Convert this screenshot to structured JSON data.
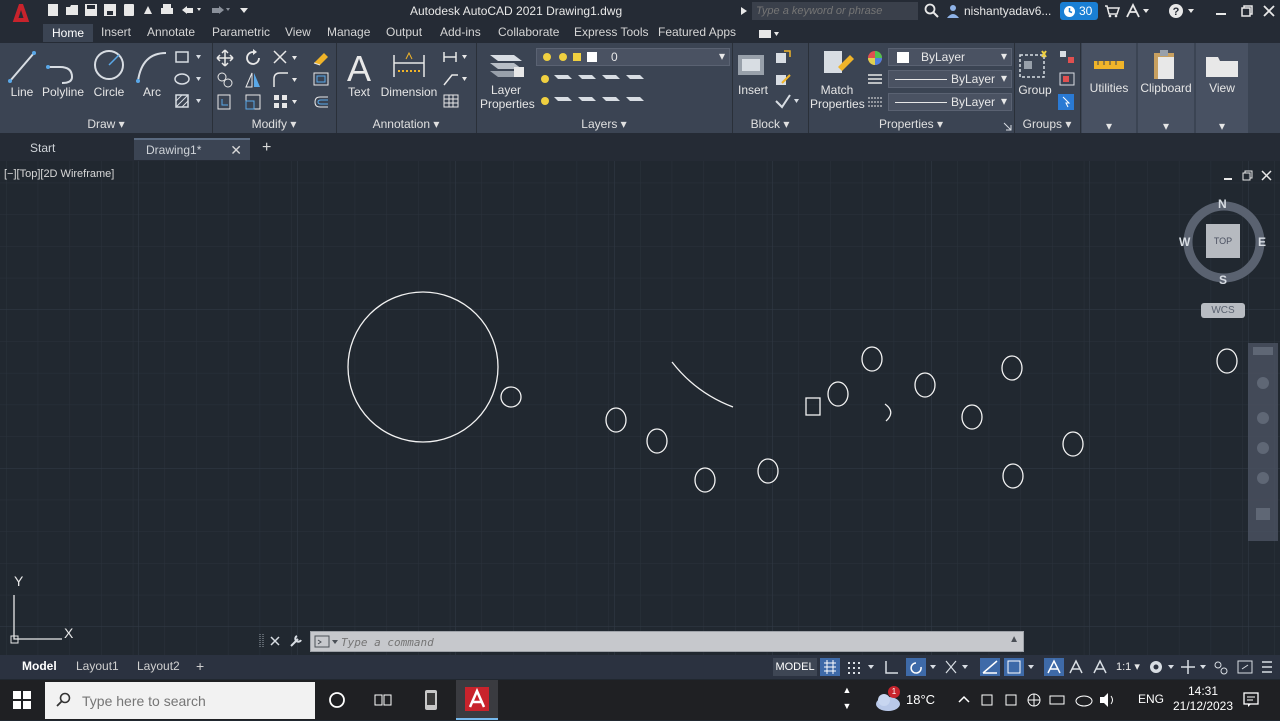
{
  "titlebar": {
    "app_title": "Autodesk AutoCAD 2021   Drawing1.dwg",
    "search_placeholder": "Type a keyword or phrase",
    "user": "nishantyadav6...",
    "trial_days": "30"
  },
  "ribbon_tabs": [
    "Home",
    "Insert",
    "Annotate",
    "Parametric",
    "View",
    "Manage",
    "Output",
    "Add-ins",
    "Collaborate",
    "Express Tools",
    "Featured Apps"
  ],
  "ribbon": {
    "draw": {
      "title": "Draw",
      "tools": [
        "Line",
        "Polyline",
        "Circle",
        "Arc"
      ]
    },
    "modify": {
      "title": "Modify"
    },
    "annotation": {
      "title": "Annotation",
      "tools": [
        "Text",
        "Dimension"
      ]
    },
    "layers": {
      "title": "Layers",
      "layer_properties": [
        "Layer",
        "Properties"
      ],
      "current_layer": "0"
    },
    "block": {
      "title": "Block",
      "insert": "Insert"
    },
    "properties": {
      "title": "Properties",
      "match": [
        "Match",
        "Properties"
      ],
      "color": "ByLayer",
      "linetype": "ByLayer",
      "lineweight": "ByLayer"
    },
    "groups": {
      "title": "Groups",
      "group": "Group"
    },
    "utilities": "Utilities",
    "clipboard": "Clipboard",
    "view": "View"
  },
  "doc_tabs": {
    "start": "Start",
    "drawing": "Drawing1*"
  },
  "viewport": {
    "label": "[−][Top][2D Wireframe]",
    "viewcube": {
      "n": "N",
      "s": "S",
      "e": "E",
      "w": "W",
      "face": "TOP",
      "wcs": "WCS"
    },
    "ucs": {
      "x": "X",
      "y": "Y"
    }
  },
  "command_line": {
    "placeholder": "Type a command"
  },
  "layout_tabs": [
    "Model",
    "Layout1",
    "Layout2"
  ],
  "status": {
    "model": "MODEL",
    "scale": "1:1"
  },
  "taskbar": {
    "search_placeholder": "Type here to search",
    "weather_temp": "18°C",
    "weather_badge": "1",
    "language": "ENG",
    "time": "14:31",
    "date": "21/12/2023"
  },
  "colors": {
    "ribbon_bg": "#3b4453",
    "canvas_bg": "#212830",
    "autocad_red": "#c8232c",
    "trial_blue": "#1a7fd4"
  }
}
